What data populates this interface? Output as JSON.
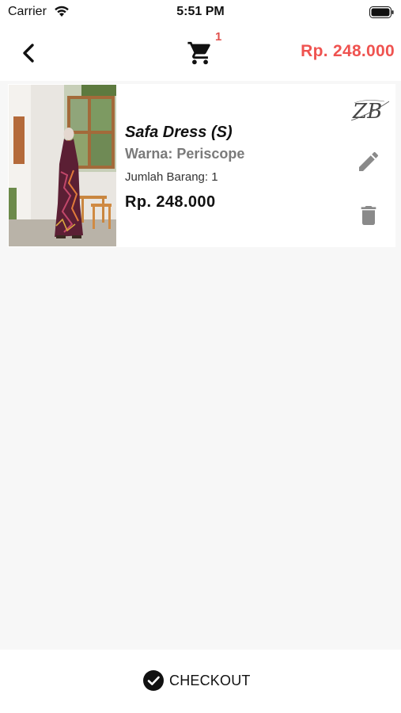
{
  "status_bar": {
    "carrier": "Carrier",
    "time": "5:51 PM"
  },
  "nav": {
    "cart_count": "1",
    "total_price": "Rp. 248.000"
  },
  "cart_items": [
    {
      "name": "Safa Dress (S)",
      "color": "Warna: Periscope",
      "quantity": "Jumlah Barang: 1",
      "price": "Rp. 248.000",
      "brand_logo_text": "ZB"
    }
  ],
  "checkout": {
    "label": "CHECKOUT"
  },
  "colors": {
    "accent_red": "#ef5350",
    "icon_gray": "#8a8a8a",
    "background": "#f7f7f7"
  },
  "icons": [
    "wifi-icon",
    "battery-icon",
    "back-arrow-icon",
    "cart-icon",
    "edit-pencil-icon",
    "trash-icon",
    "check-circle-icon"
  ]
}
